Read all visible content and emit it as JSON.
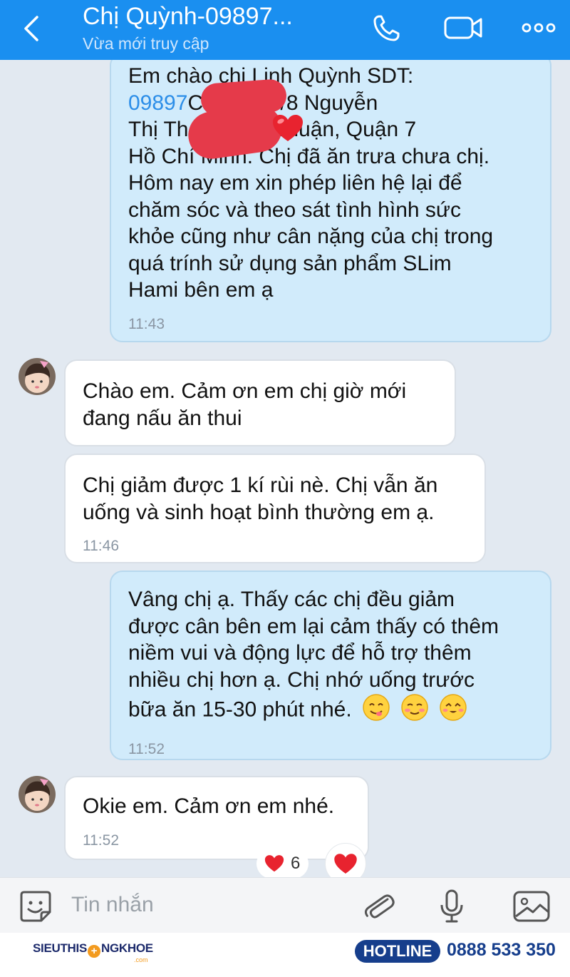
{
  "header": {
    "title": "Chị Quỳnh-09897...",
    "status": "Vừa mới truy cập",
    "color": "#1a8ff0"
  },
  "messages": [
    {
      "direction": "out",
      "text_before_phone": "Em chào chị  Linh Quỳnh SDT:",
      "phone": "09897",
      "text_after_phone": "C: 176/20/8 Nguyễn\nThị Th          ng Bình Thuận, Quận 7\nHồ Chí Minh. Chị đã ăn trưa chưa chị.\nHôm nay em xin phép liên hệ lại để\nchăm sóc và theo sát tình hình sức\nkhỏe cũng như cân nặng của chị trong\nquá trính sử dụng sản phẩm SLim\nHami bên em ạ",
      "time": "11:43"
    },
    {
      "direction": "in",
      "text": " Chào em. Cảm ơn em chị giờ mới\nđang nấu ăn thui"
    },
    {
      "direction": "in",
      "text": "Chị giảm được 1 kí rùi nè. Chị vẫn ăn\nuống và sinh hoạt bình thường em ạ.",
      "time": "11:46"
    },
    {
      "direction": "out",
      "text": "Vâng chị ạ. Thấy các chị đều giảm\nđược cân bên em lại cảm thấy có thêm\nniềm vui và động lực để hỗ trợ thêm\nnhiều chị hơn ạ. Chị nhớ uống trước\nbữa ăn 15-30 phút nhé.",
      "emojis": [
        "yum-emoji",
        "blush-emoji",
        "happy-emoji"
      ],
      "time": "11:52"
    },
    {
      "direction": "in",
      "text": "Okie em. Cảm ơn em nhé.",
      "time": "11:52",
      "reaction_count": "6",
      "reaction_icon": "heart-icon"
    }
  ],
  "input": {
    "placeholder": "Tin nhắn"
  },
  "footer": {
    "brand_left": "SIEUTHIS",
    "brand_right": "NGKHOE",
    "brand_sub": ".com",
    "hotline_label": "HOTLINE",
    "hotline_number": "0888 533 350"
  },
  "colors": {
    "outgoing_bubble": "#d1ebfb",
    "incoming_bubble": "#ffffff",
    "background": "#e2e9f1",
    "heart": "#e8232f",
    "footer_brand": "#163e8c"
  },
  "icons": {
    "back": "chevron-left-icon",
    "call": "phone-icon",
    "video": "video-camera-icon",
    "more": "more-dots-icon",
    "sticker": "sticker-face-icon",
    "attach": "paperclip-icon",
    "mic": "microphone-icon",
    "image": "image-icon"
  }
}
